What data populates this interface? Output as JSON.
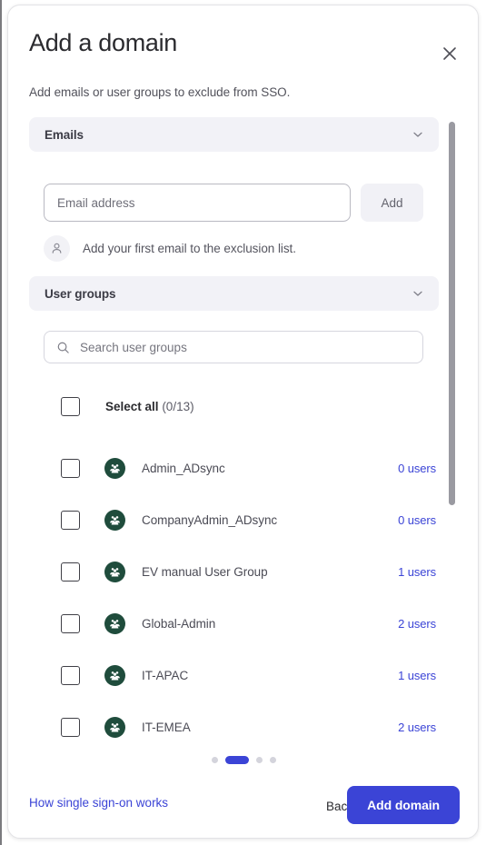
{
  "dialog": {
    "title": "Add a domain",
    "subtitle": "Add emails or user groups to exclude from SSO.",
    "close_icon": "close-icon"
  },
  "sections": {
    "emails": {
      "label": "Emails",
      "chevron_icon": "chevron-down-icon",
      "email_input_placeholder": "Email address",
      "email_input_value": "",
      "add_label": "Add",
      "empty_hint": "Add your first email to the exclusion list.",
      "empty_hint_icon": "person-icon"
    },
    "user_groups": {
      "label": "User groups",
      "chevron_icon": "chevron-down-icon",
      "search_placeholder": "Search user groups",
      "search_value": "",
      "search_icon": "search-icon",
      "select_all_label": "Select all",
      "select_all_count": "(0/13)",
      "rows": [
        {
          "name": "Admin_ADsync",
          "users": "0 users",
          "checked": false,
          "avatar_icon": "group-icon"
        },
        {
          "name": "CompanyAdmin_ADsync",
          "users": "0 users",
          "checked": false,
          "avatar_icon": "group-icon"
        },
        {
          "name": "EV manual User Group",
          "users": "1 users",
          "checked": false,
          "avatar_icon": "group-icon"
        },
        {
          "name": "Global-Admin",
          "users": "2 users",
          "checked": false,
          "avatar_icon": "group-icon"
        },
        {
          "name": "IT-APAC",
          "users": "1 users",
          "checked": false,
          "avatar_icon": "group-icon"
        },
        {
          "name": "IT-EMEA",
          "users": "2 users",
          "checked": false,
          "avatar_icon": "group-icon"
        }
      ]
    }
  },
  "pagination": {
    "total": 4,
    "active_index": 1
  },
  "footer": {
    "help_link": "How single sign-on works",
    "back_label": "Back",
    "primary_label": "Add domain"
  },
  "colors": {
    "accent": "#3b44d6",
    "avatar_green": "#1f4c3c",
    "pill_bg": "#f2f2f7",
    "text_primary": "#2b2b2f",
    "text_secondary": "#55555f"
  }
}
